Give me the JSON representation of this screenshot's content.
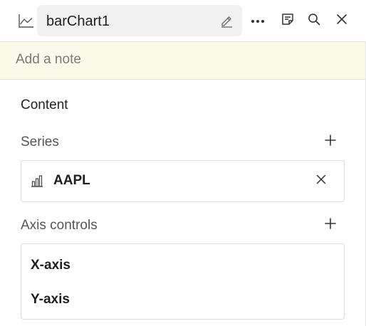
{
  "header": {
    "chart_type_icon": "line-chart-icon",
    "title": "barChart1",
    "edit_icon": "pencil-icon",
    "actions": [
      {
        "name": "more-options",
        "icon": "ellipsis-icon"
      },
      {
        "name": "notes",
        "icon": "note-icon"
      },
      {
        "name": "search",
        "icon": "search-icon"
      },
      {
        "name": "close",
        "icon": "close-icon"
      }
    ]
  },
  "note": {
    "placeholder": "Add a note"
  },
  "content": {
    "section_title": "Content",
    "series": {
      "label": "Series",
      "add_icon": "plus-icon",
      "items": [
        {
          "name": "AAPL",
          "icon": "bar-chart-icon",
          "remove_icon": "close-icon"
        }
      ]
    },
    "axis_controls": {
      "label": "Axis controls",
      "add_icon": "plus-icon",
      "items": [
        {
          "label": "X-axis"
        },
        {
          "label": "Y-axis"
        }
      ]
    }
  },
  "colors": {
    "note_background": "#fbf9ea",
    "title_box_background": "#f1f1f1",
    "border": "#dcdcdc"
  }
}
